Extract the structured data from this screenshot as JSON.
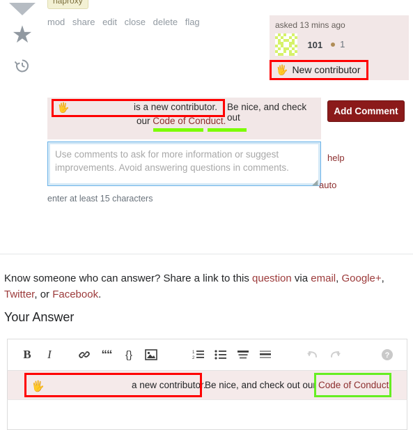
{
  "post": {
    "tag": "haproxy",
    "actions": [
      "mod",
      "share",
      "edit",
      "close",
      "delete",
      "flag"
    ],
    "rail": {
      "downvote_icon": "downvote-arrow-icon",
      "star_icon": "star-icon",
      "history_icon": "history-clock-icon"
    }
  },
  "user_card": {
    "asked": "asked 13 mins ago",
    "avatar_icon": "identicon-avatar",
    "reputation": "101",
    "badge_bronze_count": "1",
    "new_contributor_badge": {
      "icon": "waving-hand-icon",
      "label": "New contributor"
    }
  },
  "comment_notice": {
    "icon": "waving-hand-icon",
    "text_before": "is a new contributor.",
    "text_after": "Be nice, and check out",
    "text_line2_prefix": "our",
    "code_of_conduct_link": "Code of Conduct."
  },
  "comment_form": {
    "placeholder": "Use comments to ask for more information or suggest improvements. Avoid answering questions in comments.",
    "value": "",
    "add_comment_button": "Add Comment",
    "help_link": "help",
    "auto_link": "auto",
    "min_chars_hint": "enter at least 15 characters",
    "resize_grip_icon": "resize-grip-icon"
  },
  "share_section": {
    "text_1": "Know someone who can answer? Share a link to this ",
    "link_question": "question",
    "text_2": " via ",
    "link_email": "email",
    "text_3": ", ",
    "link_googleplus": "Google+",
    "text_4": ", ",
    "link_twitter": "Twitter",
    "text_5": ", or ",
    "link_facebook": "Facebook",
    "text_6": "."
  },
  "answer_section": {
    "heading": "Your Answer",
    "toolbar": [
      {
        "name": "bold-icon",
        "glyph": "B"
      },
      {
        "name": "italic-icon",
        "glyph": "I"
      },
      {
        "name": "link-icon",
        "glyph": "ὑ7"
      },
      {
        "name": "blockquote-icon",
        "glyph": "“"
      },
      {
        "name": "code-icon",
        "glyph": "{}"
      },
      {
        "name": "image-icon",
        "glyph": "ὛC"
      },
      {
        "name": "numbered-list-icon",
        "glyph": "1."
      },
      {
        "name": "bulleted-list-icon",
        "glyph": "•"
      },
      {
        "name": "heading-icon",
        "glyph": "H"
      },
      {
        "name": "horizontal-rule-icon",
        "glyph": "—"
      },
      {
        "name": "undo-icon",
        "glyph": "↩"
      },
      {
        "name": "redo-icon",
        "glyph": "↪"
      },
      {
        "name": "help-icon",
        "glyph": "?"
      }
    ]
  },
  "answer_notice": {
    "icon": "waving-hand-icon",
    "text_before": "a new contributor.",
    "text_after": "Be nice, and check out our",
    "code_of_conduct_link": "Code of Conduct."
  },
  "annotations": {
    "red_box_color": "#ff0000",
    "green_box_color": "#66ee22",
    "green_underline_color": "#7cfc00"
  },
  "colors": {
    "notice_bg": "#f2e7e7",
    "button_red": "#8b1a1a",
    "link_red": "#8c2d2d",
    "tag_bg": "#f3f1d4",
    "avatar_green": "#d6f26a"
  }
}
